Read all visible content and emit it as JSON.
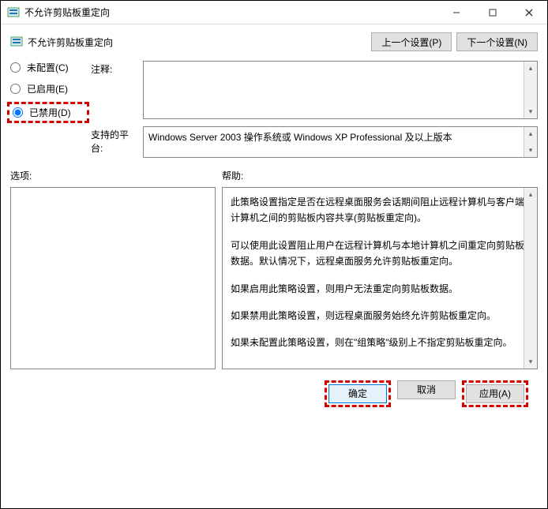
{
  "window": {
    "title": "不允许剪贴板重定向",
    "subtitle": "不允许剪贴板重定向"
  },
  "nav": {
    "prev": "上一个设置(P)",
    "next": "下一个设置(N)"
  },
  "radios": {
    "not_configured": "未配置(C)",
    "enabled": "已启用(E)",
    "disabled": "已禁用(D)"
  },
  "labels": {
    "comment": "注释:",
    "supported": "支持的平台:",
    "options": "选项:",
    "help": "帮助:"
  },
  "fields": {
    "comment": "",
    "supported": "Windows Server 2003 操作系统或 Windows XP Professional 及以上版本"
  },
  "help": {
    "p1": "此策略设置指定是否在远程桌面服务会话期间阻止远程计算机与客户端计算机之间的剪贴板内容共享(剪贴板重定向)。",
    "p2": "可以使用此设置阻止用户在远程计算机与本地计算机之间重定向剪贴板数据。默认情况下，远程桌面服务允许剪贴板重定向。",
    "p3": "如果启用此策略设置，则用户无法重定向剪贴板数据。",
    "p4": "如果禁用此策略设置，则远程桌面服务始终允许剪贴板重定向。",
    "p5": "如果未配置此策略设置，则在\"组策略\"级别上不指定剪贴板重定向。"
  },
  "buttons": {
    "ok": "确定",
    "cancel": "取消",
    "apply": "应用(A)"
  }
}
